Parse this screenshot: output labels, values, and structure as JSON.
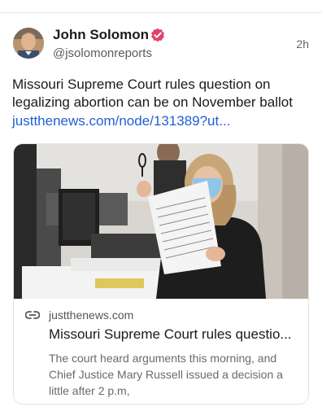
{
  "post": {
    "author_name": "John Solomon",
    "handle": "@jsolomonreports",
    "time": "2h",
    "text": "Missouri Supreme Court rules question on legalizing abortion can be on November ballot",
    "link": "justthenews.com/node/131389?ut...",
    "verified_color": "#e0426b",
    "link_color": "#1f5fd6"
  },
  "card": {
    "domain": "justthenews.com",
    "title": "Missouri Supreme Court rules questio...",
    "description": "The court heard arguments this morning, and Chief Justice Mary Russell issued a decision a little after 2 p.m,",
    "icon": "link-icon"
  }
}
